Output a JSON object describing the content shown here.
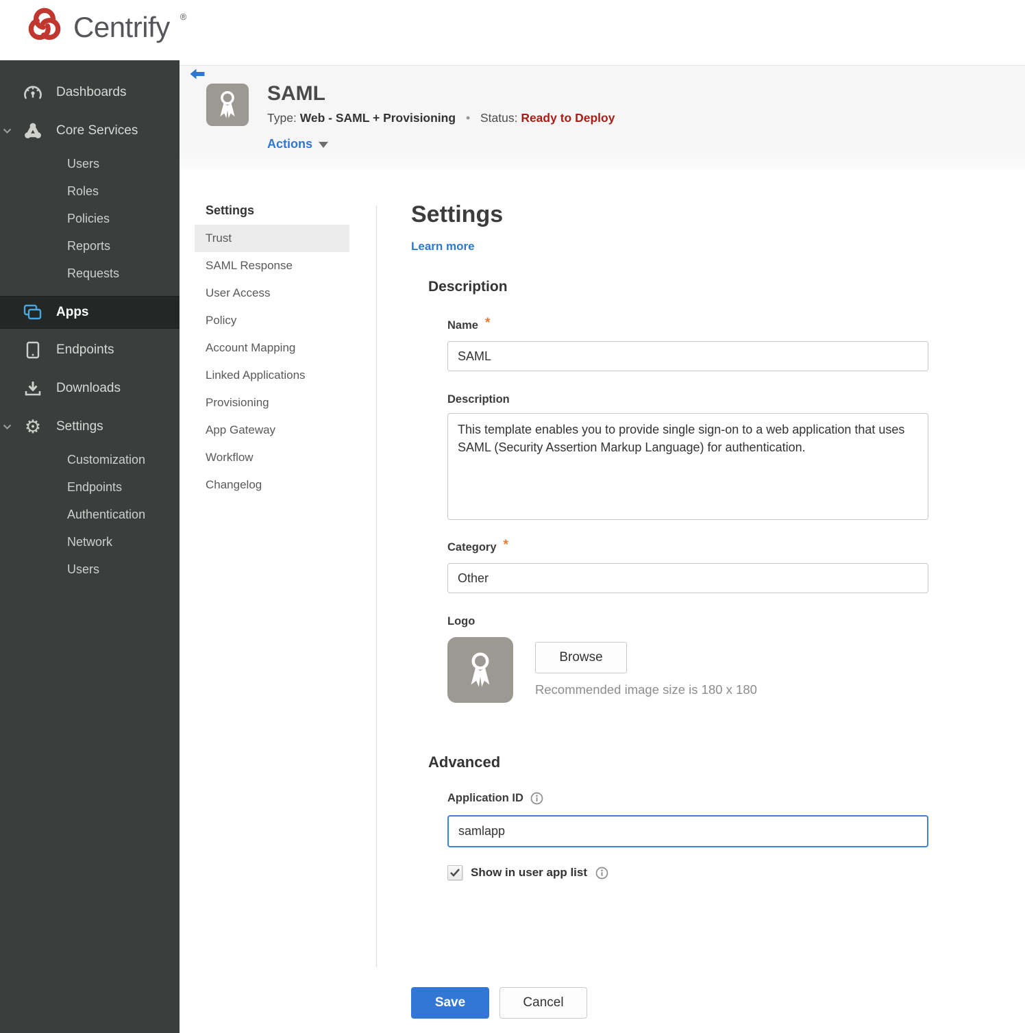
{
  "colors": {
    "brand_red": "#bf372e",
    "accent_blue": "#2e78d2",
    "status_red": "#a81f17",
    "sidebar_bg": "#3a3e3d",
    "sidebar_active_bg": "#232726",
    "band_bg": "#f6f6f7",
    "focus_blue": "#3e82d8",
    "save_blue": "#3377d6"
  },
  "header": {
    "brand": "Centrify",
    "registered_mark": "®"
  },
  "sidebar": {
    "items": [
      {
        "label": "Dashboards"
      },
      {
        "label": "Core Services"
      },
      {
        "label": "Users"
      },
      {
        "label": "Roles"
      },
      {
        "label": "Policies"
      },
      {
        "label": "Reports"
      },
      {
        "label": "Requests"
      },
      {
        "label": "Apps"
      },
      {
        "label": "Endpoints"
      },
      {
        "label": "Downloads"
      },
      {
        "label": "Settings"
      },
      {
        "label": "Customization"
      },
      {
        "label": "Endpoints"
      },
      {
        "label": "Authentication"
      },
      {
        "label": "Network"
      },
      {
        "label": "Users"
      }
    ]
  },
  "app_header": {
    "title": "SAML",
    "type_label": "Type:",
    "type_value": "Web - SAML + Provisioning",
    "separator": "•",
    "status_label": "Status:",
    "status_value": "Ready to Deploy",
    "actions_label": "Actions"
  },
  "subnav": {
    "header": "Settings",
    "items": [
      {
        "label": "Trust",
        "active": true
      },
      {
        "label": "SAML Response"
      },
      {
        "label": "User Access"
      },
      {
        "label": "Policy"
      },
      {
        "label": "Account Mapping"
      },
      {
        "label": "Linked Applications"
      },
      {
        "label": "Provisioning"
      },
      {
        "label": "App Gateway"
      },
      {
        "label": "Workflow"
      },
      {
        "label": "Changelog"
      }
    ]
  },
  "main": {
    "title": "Settings",
    "learn_more": "Learn more",
    "description_section": {
      "heading": "Description",
      "name_label": "Name",
      "required_mark": "*",
      "name_value": "SAML",
      "description_label": "Description",
      "description_value": "This template enables you to provide single sign-on to a web application that uses SAML (Security Assertion Markup Language) for authentication.",
      "category_label": "Category",
      "category_value": "Other",
      "logo_label": "Logo",
      "browse_button": "Browse",
      "logo_hint": "Recommended image size is 180 x 180"
    },
    "advanced_section": {
      "heading": "Advanced",
      "application_id_label": "Application ID",
      "application_id_value": "samlapp",
      "show_in_user_app_list_label": "Show in user app list",
      "checkbox_checked": true
    },
    "footer": {
      "save": "Save",
      "cancel": "Cancel"
    }
  }
}
